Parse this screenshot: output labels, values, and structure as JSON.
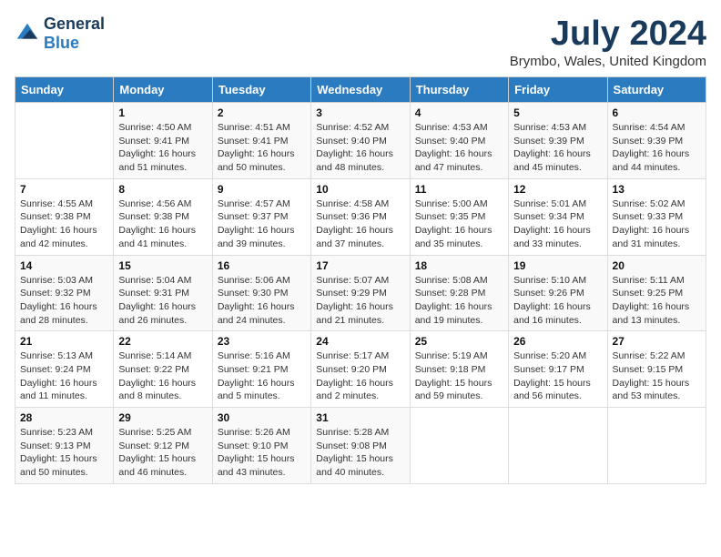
{
  "header": {
    "logo_general": "General",
    "logo_blue": "Blue",
    "title": "July 2024",
    "location": "Brymbo, Wales, United Kingdom"
  },
  "weekdays": [
    "Sunday",
    "Monday",
    "Tuesday",
    "Wednesday",
    "Thursday",
    "Friday",
    "Saturday"
  ],
  "weeks": [
    [
      {
        "day": "",
        "info": ""
      },
      {
        "day": "1",
        "info": "Sunrise: 4:50 AM\nSunset: 9:41 PM\nDaylight: 16 hours\nand 51 minutes."
      },
      {
        "day": "2",
        "info": "Sunrise: 4:51 AM\nSunset: 9:41 PM\nDaylight: 16 hours\nand 50 minutes."
      },
      {
        "day": "3",
        "info": "Sunrise: 4:52 AM\nSunset: 9:40 PM\nDaylight: 16 hours\nand 48 minutes."
      },
      {
        "day": "4",
        "info": "Sunrise: 4:53 AM\nSunset: 9:40 PM\nDaylight: 16 hours\nand 47 minutes."
      },
      {
        "day": "5",
        "info": "Sunrise: 4:53 AM\nSunset: 9:39 PM\nDaylight: 16 hours\nand 45 minutes."
      },
      {
        "day": "6",
        "info": "Sunrise: 4:54 AM\nSunset: 9:39 PM\nDaylight: 16 hours\nand 44 minutes."
      }
    ],
    [
      {
        "day": "7",
        "info": ""
      },
      {
        "day": "8",
        "info": "Sunrise: 4:56 AM\nSunset: 9:38 PM\nDaylight: 16 hours\nand 41 minutes."
      },
      {
        "day": "9",
        "info": "Sunrise: 4:57 AM\nSunset: 9:37 PM\nDaylight: 16 hours\nand 39 minutes."
      },
      {
        "day": "10",
        "info": "Sunrise: 4:58 AM\nSunset: 9:36 PM\nDaylight: 16 hours\nand 37 minutes."
      },
      {
        "day": "11",
        "info": "Sunrise: 5:00 AM\nSunset: 9:35 PM\nDaylight: 16 hours\nand 35 minutes."
      },
      {
        "day": "12",
        "info": "Sunrise: 5:01 AM\nSunset: 9:34 PM\nDaylight: 16 hours\nand 33 minutes."
      },
      {
        "day": "13",
        "info": "Sunrise: 5:02 AM\nSunset: 9:33 PM\nDaylight: 16 hours\nand 31 minutes."
      }
    ],
    [
      {
        "day": "14",
        "info": ""
      },
      {
        "day": "15",
        "info": "Sunrise: 5:04 AM\nSunset: 9:31 PM\nDaylight: 16 hours\nand 26 minutes."
      },
      {
        "day": "16",
        "info": "Sunrise: 5:06 AM\nSunset: 9:30 PM\nDaylight: 16 hours\nand 24 minutes."
      },
      {
        "day": "17",
        "info": "Sunrise: 5:07 AM\nSunset: 9:29 PM\nDaylight: 16 hours\nand 21 minutes."
      },
      {
        "day": "18",
        "info": "Sunrise: 5:08 AM\nSunset: 9:28 PM\nDaylight: 16 hours\nand 19 minutes."
      },
      {
        "day": "19",
        "info": "Sunrise: 5:10 AM\nSunset: 9:26 PM\nDaylight: 16 hours\nand 16 minutes."
      },
      {
        "day": "20",
        "info": "Sunrise: 5:11 AM\nSunset: 9:25 PM\nDaylight: 16 hours\nand 13 minutes."
      }
    ],
    [
      {
        "day": "21",
        "info": ""
      },
      {
        "day": "22",
        "info": "Sunrise: 5:14 AM\nSunset: 9:22 PM\nDaylight: 16 hours\nand 8 minutes."
      },
      {
        "day": "23",
        "info": "Sunrise: 5:16 AM\nSunset: 9:21 PM\nDaylight: 16 hours\nand 5 minutes."
      },
      {
        "day": "24",
        "info": "Sunrise: 5:17 AM\nSunset: 9:20 PM\nDaylight: 16 hours\nand 2 minutes."
      },
      {
        "day": "25",
        "info": "Sunrise: 5:19 AM\nSunset: 9:18 PM\nDaylight: 15 hours\nand 59 minutes."
      },
      {
        "day": "26",
        "info": "Sunrise: 5:20 AM\nSunset: 9:17 PM\nDaylight: 15 hours\nand 56 minutes."
      },
      {
        "day": "27",
        "info": "Sunrise: 5:22 AM\nSunset: 9:15 PM\nDaylight: 15 hours\nand 53 minutes."
      }
    ],
    [
      {
        "day": "28",
        "info": "Sunrise: 5:23 AM\nSunset: 9:13 PM\nDaylight: 15 hours\nand 50 minutes."
      },
      {
        "day": "29",
        "info": "Sunrise: 5:25 AM\nSunset: 9:12 PM\nDaylight: 15 hours\nand 46 minutes."
      },
      {
        "day": "30",
        "info": "Sunrise: 5:26 AM\nSunset: 9:10 PM\nDaylight: 15 hours\nand 43 minutes."
      },
      {
        "day": "31",
        "info": "Sunrise: 5:28 AM\nSunset: 9:08 PM\nDaylight: 15 hours\nand 40 minutes."
      },
      {
        "day": "",
        "info": ""
      },
      {
        "day": "",
        "info": ""
      },
      {
        "day": "",
        "info": ""
      }
    ]
  ],
  "week7_sunday": "Sunrise: 4:55 AM\nSunset: 9:38 PM\nDaylight: 16 hours\nand 42 minutes.",
  "week14_sunday": "Sunrise: 5:03 AM\nSunset: 9:32 PM\nDaylight: 16 hours\nand 28 minutes.",
  "week21_sunday": "Sunrise: 5:13 AM\nSunset: 9:24 PM\nDaylight: 16 hours\nand 11 minutes."
}
